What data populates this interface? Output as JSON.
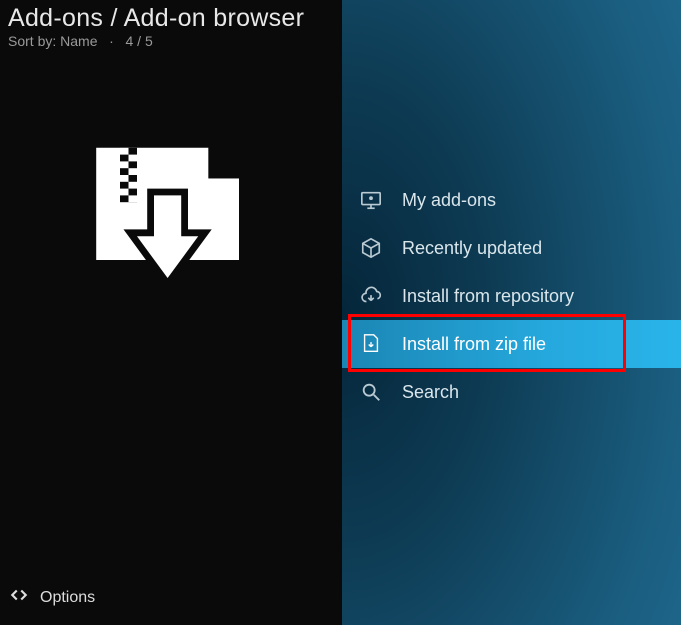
{
  "header": {
    "breadcrumb": "Add-ons / Add-on browser",
    "sort_label": "Sort by: Name",
    "separator": "·",
    "counter": "4 / 5"
  },
  "menu": {
    "items": [
      {
        "label": "My add-ons"
      },
      {
        "label": "Recently updated"
      },
      {
        "label": "Install from repository"
      },
      {
        "label": "Install from zip file"
      },
      {
        "label": "Search"
      }
    ]
  },
  "footer": {
    "options_label": "Options"
  }
}
